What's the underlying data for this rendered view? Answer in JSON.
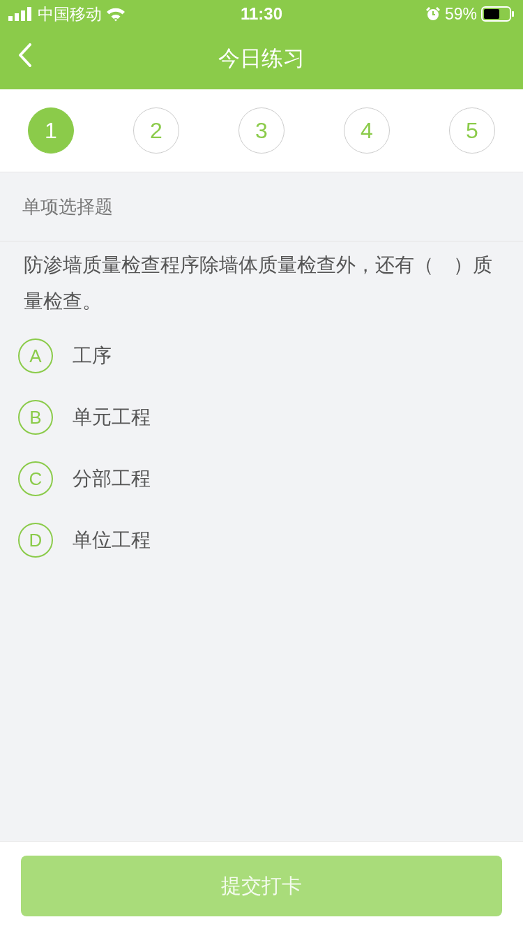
{
  "status_bar": {
    "carrier": "中国移动",
    "time": "11:30",
    "battery": "59%"
  },
  "nav": {
    "title": "今日练习"
  },
  "steps": [
    {
      "label": "1",
      "selected": true
    },
    {
      "label": "2",
      "selected": false
    },
    {
      "label": "3",
      "selected": false
    },
    {
      "label": "4",
      "selected": false
    },
    {
      "label": "5",
      "selected": false
    }
  ],
  "section": {
    "title": "单项选择题"
  },
  "question": {
    "text": "防渗墙质量检查程序除墙体质量检查外，还有（　）质量检查。"
  },
  "options": [
    {
      "letter": "A",
      "text": "工序",
      "selected": false
    },
    {
      "letter": "B",
      "text": "单元工程",
      "selected": false
    },
    {
      "letter": "C",
      "text": "分部工程",
      "selected": false
    },
    {
      "letter": "D",
      "text": "单位工程",
      "selected": false
    }
  ],
  "submit": {
    "label": "提交打卡",
    "disabled": true
  }
}
